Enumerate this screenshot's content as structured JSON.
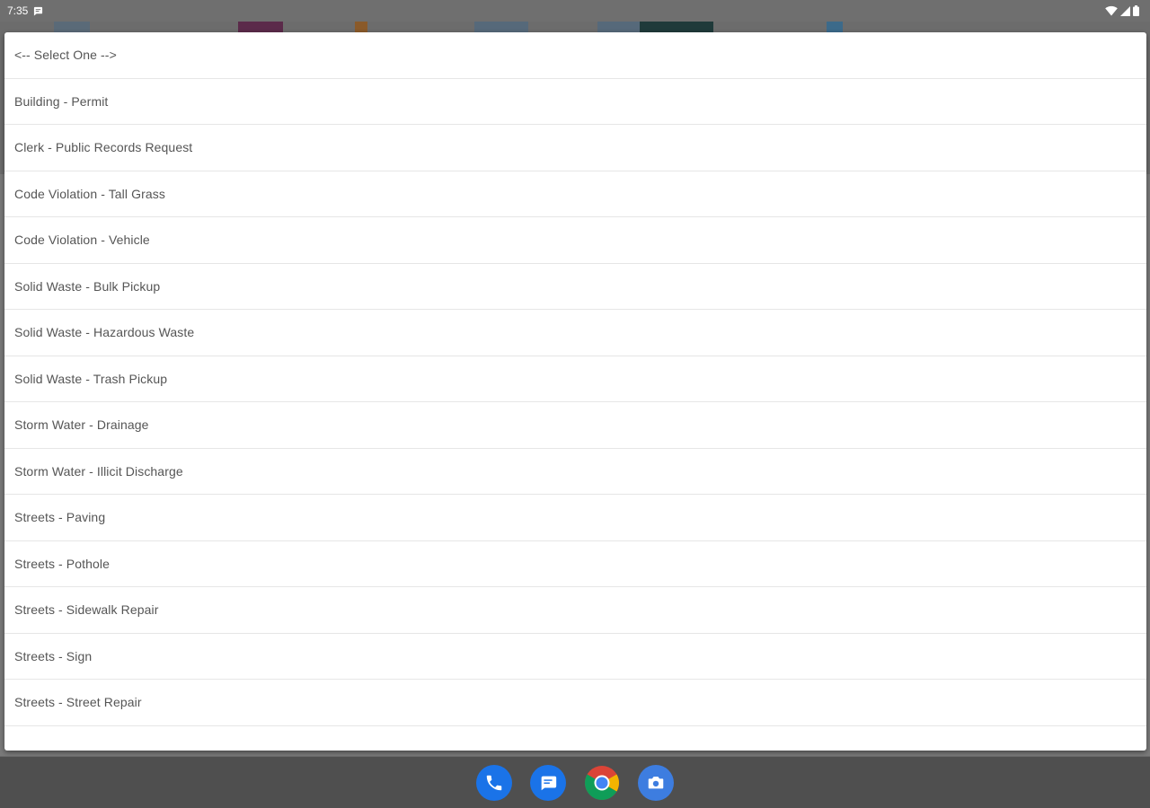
{
  "status_bar": {
    "time": "7:35"
  },
  "dropdown": {
    "options": [
      "<-- Select One -->",
      "Building - Permit",
      "Clerk - Public Records Request",
      "Code Violation - Tall Grass",
      "Code Violation - Vehicle",
      "Solid Waste - Bulk Pickup",
      "Solid Waste - Hazardous Waste",
      "Solid Waste - Trash Pickup",
      "Storm Water - Drainage",
      "Storm Water - Illicit Discharge",
      "Streets - Paving",
      "Streets - Pothole",
      "Streets - Sidewalk Repair",
      "Streets - Sign",
      "Streets - Street Repair"
    ]
  },
  "dock": {
    "icons": [
      "phone-icon",
      "messages-icon",
      "chrome-icon",
      "camera-icon"
    ]
  },
  "colors": {
    "accent": "#1a73e8",
    "scrim": "#7a7a7a"
  }
}
